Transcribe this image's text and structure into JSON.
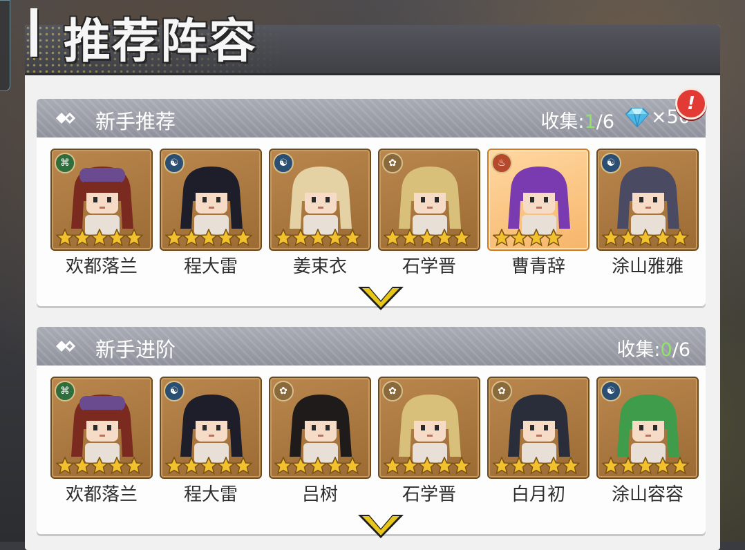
{
  "page_title": "推荐阵容",
  "sections": [
    {
      "title": "新手推荐",
      "collect_label": "收集:",
      "collect_current": "1",
      "collect_total": "/6",
      "reward_icon": "diamond-icon",
      "reward_count": "×50",
      "alert": "!",
      "heroes": [
        {
          "name": "欢都落兰",
          "faction": "dna",
          "stars": 5,
          "hair": "#7a2a1e",
          "hat": "#6a4b8f",
          "highlight": false
        },
        {
          "name": "程大雷",
          "faction": "yin",
          "stars": 5,
          "hair": "#1d1e2a",
          "hat": "",
          "highlight": false
        },
        {
          "name": "姜束衣",
          "faction": "yin",
          "stars": 5,
          "hair": "#e4d2a4",
          "hat": "",
          "highlight": false
        },
        {
          "name": "石学晋",
          "faction": "lotus",
          "stars": 5,
          "hair": "#d8c07a",
          "hat": "",
          "highlight": false
        },
        {
          "name": "曹青辞",
          "faction": "fire",
          "stars": 4,
          "hair": "#7a3ab0",
          "hat": "",
          "highlight": true
        },
        {
          "name": "涂山雅雅",
          "faction": "yin",
          "stars": 5,
          "hair": "#4b4a63",
          "hat": "",
          "highlight": false
        }
      ]
    },
    {
      "title": "新手进阶",
      "collect_label": "收集:",
      "collect_current": "0",
      "collect_total": "/6",
      "heroes": [
        {
          "name": "欢都落兰",
          "faction": "dna",
          "stars": 5,
          "hair": "#7a2a1e",
          "hat": "#6a4b8f",
          "highlight": false
        },
        {
          "name": "程大雷",
          "faction": "yin",
          "stars": 5,
          "hair": "#1d1e2a",
          "hat": "",
          "highlight": false
        },
        {
          "name": "吕树",
          "faction": "lotus",
          "stars": 5,
          "hair": "#1f1b1a",
          "hat": "",
          "highlight": false
        },
        {
          "name": "石学晋",
          "faction": "lotus",
          "stars": 5,
          "hair": "#d8c07a",
          "hat": "",
          "highlight": false
        },
        {
          "name": "白月初",
          "faction": "lotus",
          "stars": 5,
          "hair": "#2a2d3a",
          "hat": "",
          "highlight": false
        },
        {
          "name": "涂山容容",
          "faction": "yin",
          "stars": 5,
          "hair": "#3f9c4a",
          "hat": "",
          "highlight": false
        }
      ]
    }
  ],
  "colors": {
    "star": "#f2c12e",
    "star_outline": "#7a5312",
    "chevron": "#e8c617",
    "green_count": "#8fe36b"
  }
}
